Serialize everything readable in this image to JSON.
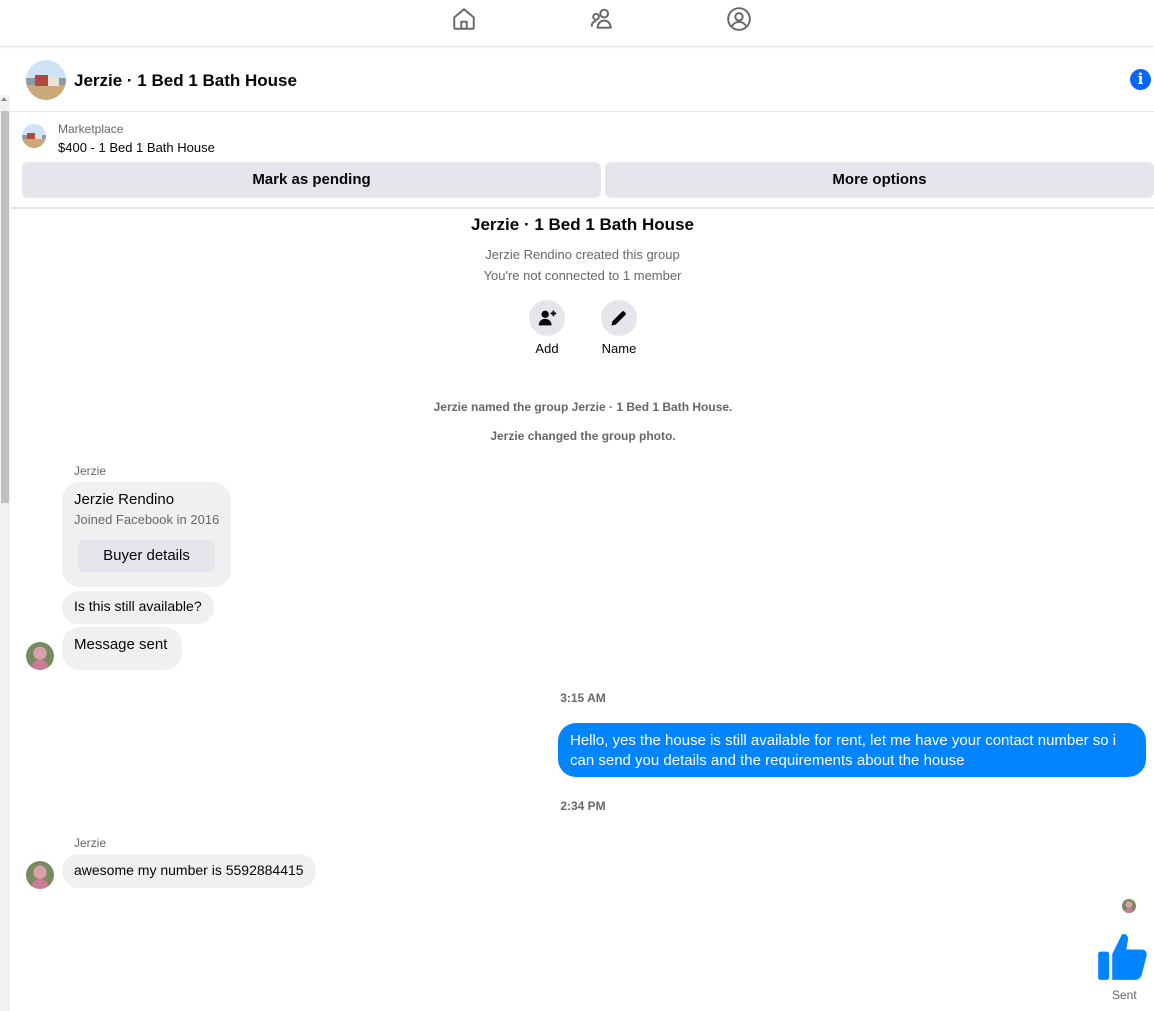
{
  "nav": {
    "icons": [
      "home-icon",
      "friends-icon",
      "profile-icon"
    ]
  },
  "header": {
    "title": "Jerzie · 1 Bed 1 Bath House",
    "info_icon": "info-icon"
  },
  "marketplace": {
    "label": "Marketplace",
    "item": "$400 - 1 Bed 1 Bath House",
    "buttons": {
      "mark_pending": "Mark as pending",
      "more_options": "More options"
    }
  },
  "group_intro": {
    "title": "Jerzie · 1 Bed 1 Bath House",
    "created": "Jerzie Rendino created this group",
    "not_connected": "You're not connected to 1 member",
    "actions": {
      "add": "Add",
      "name": "Name"
    }
  },
  "system_messages": [
    "Jerzie named the group Jerzie · 1 Bed 1 Bath House.",
    "Jerzie changed the group photo."
  ],
  "thread": {
    "sender_1": "Jerzie",
    "buyer_card": {
      "name": "Jerzie Rendino",
      "joined": "Joined Facebook in 2016",
      "button": "Buyer details"
    },
    "msg_available": "Is this still available?",
    "msg_sent_notice": "Message sent",
    "timestamp_1": "3:15 AM",
    "msg_reply": "Hello, yes the house is still available for rent, let me have your contact number so i can send you details and the requirements about the house",
    "timestamp_2": "2:34 PM",
    "sender_2": "Jerzie",
    "msg_number": "awesome my number is 5592884415",
    "status": "Sent"
  },
  "colors": {
    "accent": "#0084ff",
    "info": "#0866ff",
    "bubble_in": "#f0f0f0",
    "button_bg": "#e4e6eb"
  }
}
